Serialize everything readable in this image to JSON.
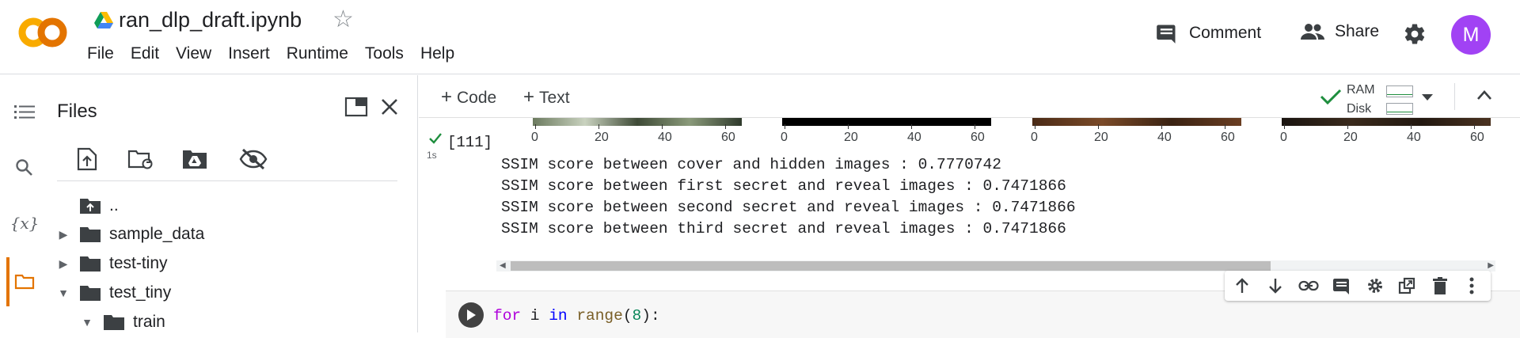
{
  "app": {
    "notebook_title": "ran_dlp_draft.ipynb",
    "logo_text": "CO",
    "colors": {
      "logo_orange": "#f9ab00",
      "accent_orange": "#e37400",
      "avatar": "#a142f4",
      "success_green": "#1e8e3e"
    }
  },
  "menu": [
    "File",
    "Edit",
    "View",
    "Insert",
    "Runtime",
    "Tools",
    "Help"
  ],
  "header_actions": {
    "comment_label": "Comment",
    "share_label": "Share",
    "avatar_initial": "M"
  },
  "files_pane": {
    "title": "Files",
    "tree": [
      {
        "label": "..",
        "type": "parent"
      },
      {
        "label": "sample_data",
        "type": "folder",
        "expanded": false
      },
      {
        "label": "test-tiny",
        "type": "folder",
        "expanded": false
      },
      {
        "label": "test_tiny",
        "type": "folder",
        "expanded": true
      },
      {
        "label": "train",
        "type": "folder",
        "expanded": true
      }
    ]
  },
  "toolbar": {
    "code_label": "Code",
    "text_label": "Text",
    "ram_label": "RAM",
    "disk_label": "Disk"
  },
  "output_cell": {
    "execution_count": "[111]",
    "exec_time": "1s",
    "axis_ticks": [
      "0",
      "20",
      "40",
      "60"
    ],
    "lines": [
      "SSIM score between cover and hidden images : 0.7770742",
      "SSIM score between first secret and reveal images : 0.7471866",
      "SSIM score between second secret and reveal images : 0.7471866",
      "SSIM score between third secret and reveal images : 0.7471866"
    ]
  },
  "code_cell": {
    "tokens": {
      "kw_for": "for",
      "var": " i ",
      "kw_in": "in",
      "fn": " range",
      "open": "(",
      "num": "8",
      "close": "):"
    }
  }
}
